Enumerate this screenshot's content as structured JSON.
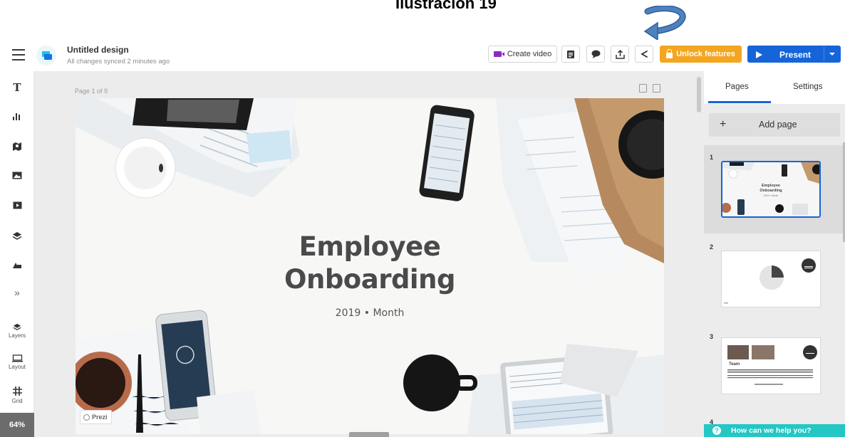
{
  "caption": "Ilustración 19",
  "header": {
    "title": "Untitled design",
    "status": "All changes synced 2 minutes ago",
    "create_video_label": "Create video",
    "unlock_label": "Unlock features",
    "present_label": "Present",
    "accent": "#1565d8",
    "unlock_color": "#f4a620"
  },
  "sidebar": {
    "items": [
      {
        "icon": "text-icon",
        "glyph": "T"
      },
      {
        "icon": "chart-icon",
        "glyph": ""
      },
      {
        "icon": "map-icon",
        "glyph": ""
      },
      {
        "icon": "image-icon",
        "glyph": ""
      },
      {
        "icon": "video-icon",
        "glyph": ""
      },
      {
        "icon": "layers-icon",
        "glyph": ""
      },
      {
        "icon": "shapes-icon",
        "glyph": ""
      },
      {
        "icon": "more-icon",
        "glyph": "»"
      }
    ],
    "layers_label": "Layers",
    "layout_label": "Layout",
    "grid_label": "Grid",
    "zoom": "64%"
  },
  "canvas": {
    "page_label": "Page 1 of 9",
    "slide_title_line1": "Employee",
    "slide_title_line2": "Onboarding",
    "slide_subtitle": "2019  •  Month",
    "brand_badge": "Prezi"
  },
  "right_panel": {
    "tab_pages": "Pages",
    "tab_settings": "Settings",
    "add_page": "Add page",
    "pages": [
      {
        "num": "1",
        "thumb_title": "Employee Onboarding",
        "thumb_sub": "2019 • Month"
      },
      {
        "num": "2"
      },
      {
        "num": "3",
        "thumb_text": "Team"
      },
      {
        "num": "4"
      }
    ],
    "help": "How can we help you?"
  }
}
